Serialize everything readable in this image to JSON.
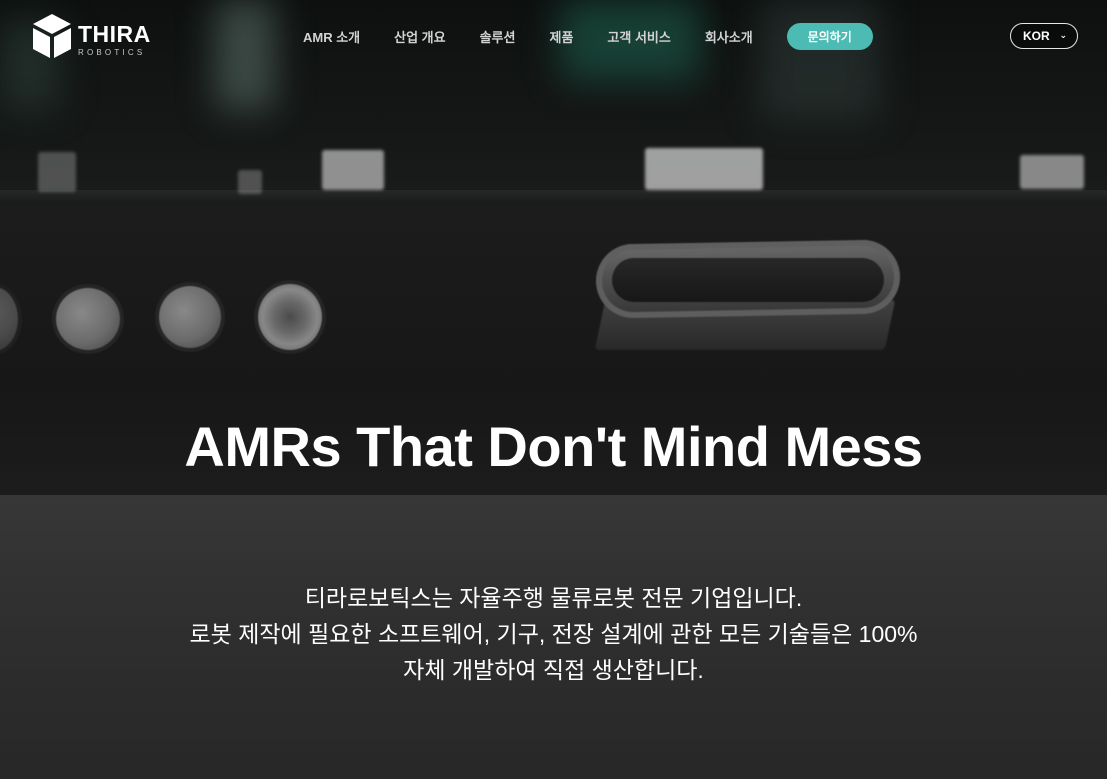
{
  "brand": {
    "name": "THIRA",
    "sub": "ROBOTICS",
    "logo_icon": "hexagon-cube-icon"
  },
  "nav": {
    "items": [
      {
        "label": "AMR 소개"
      },
      {
        "label": "산업 개요"
      },
      {
        "label": "솔루션"
      },
      {
        "label": "제품"
      },
      {
        "label": "고객 서비스"
      },
      {
        "label": "회사소개"
      }
    ],
    "contact_label": "문의하기"
  },
  "language": {
    "selected": "KOR",
    "chevron_icon": "chevron-down-icon"
  },
  "hero": {
    "title": "AMRs That Don't Mind Mess",
    "lines": [
      "티라로보틱스는 자율주행 물류로봇 전문 기업입니다.",
      "로봇 제작에 필요한 소프트웨어, 기구, 전장 설계에 관한 모든 기술들은 100%",
      "자체 개발하여 직접 생산합니다."
    ]
  },
  "colors": {
    "accent": "#4bbbb3",
    "text": "#ffffff",
    "nav_text": "#d3d3d3"
  }
}
